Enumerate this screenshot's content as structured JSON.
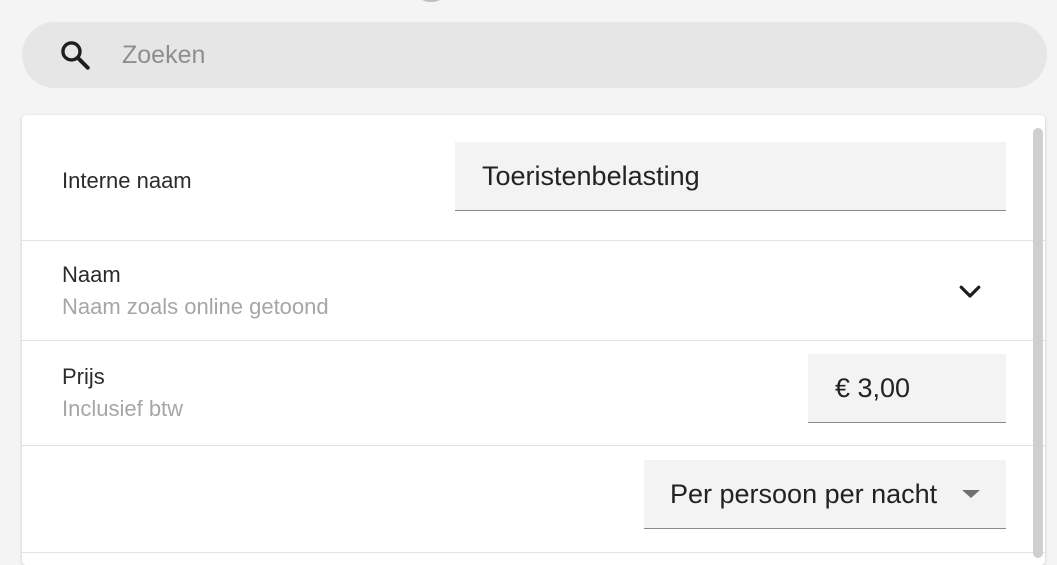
{
  "search": {
    "placeholder": "Zoeken",
    "icon": "search-icon"
  },
  "form": {
    "internal_name": {
      "label": "Interne naam",
      "value": "Toeristenbelasting"
    },
    "name": {
      "label": "Naam",
      "sublabel": "Naam zoals online getoond",
      "icon": "chevron-down-icon"
    },
    "price": {
      "label": "Prijs",
      "sublabel": "Inclusief btw",
      "value": "€ 3,00"
    },
    "unit": {
      "selected": "Per persoon per nacht",
      "icon": "caret-down-icon"
    }
  },
  "colors": {
    "background": "#f4f4f4",
    "search_bg": "#e6e6e6",
    "card_bg": "#ffffff",
    "field_bg": "#f3f3f3",
    "muted_text": "#a6a6a6"
  }
}
